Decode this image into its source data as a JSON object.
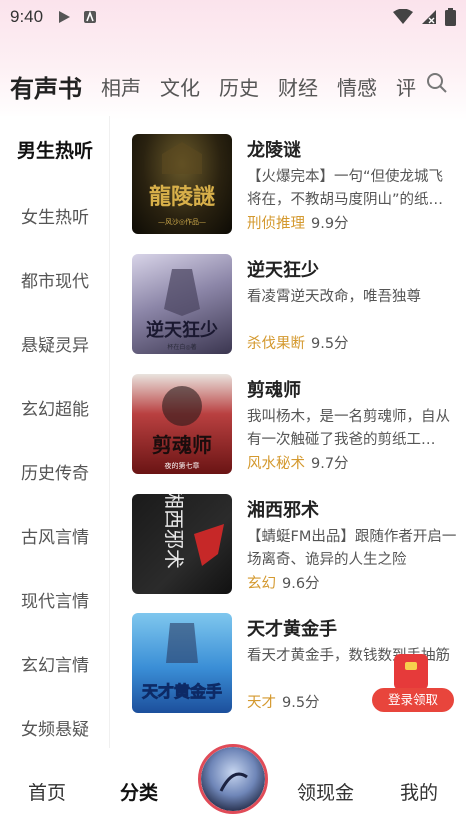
{
  "status_bar": {
    "time": "9:40"
  },
  "tabs": [
    "有声书",
    "相声",
    "文化",
    "历史",
    "财经",
    "情感",
    "评"
  ],
  "sidebar": [
    "男生热听",
    "女生热听",
    "都市现代",
    "悬疑灵异",
    "玄幻超能",
    "历史传奇",
    "古风言情",
    "现代言情",
    "玄幻言情",
    "女频悬疑"
  ],
  "books": [
    {
      "title": "龙陵谜",
      "description": "【火爆完本】一句“但使龙城飞将在，不教胡马度阴山”的纸…",
      "genre": "刑侦推理",
      "score": "9.9分",
      "cover_text": "龍陵謎",
      "cover_sub": "—风沙◎作品—"
    },
    {
      "title": "逆天狂少",
      "description": "看凌霄逆天改命，唯吾独尊",
      "genre": "杀伐果断",
      "score": "9.5分",
      "cover_text": "逆天狂少",
      "cover_sub": "杯在白◎著"
    },
    {
      "title": "剪魂师",
      "description": "我叫杨木，是一名剪魂师，自从有一次触碰了我爸的剪纸工…",
      "genre": "风水秘术",
      "score": "9.7分",
      "cover_text": "剪魂师",
      "cover_sub": "夜的第七章"
    },
    {
      "title": "湘西邪术",
      "description": "【蜻蜓FM出品】跟随作者开启一场离奇、诡异的人生之险",
      "genre": "玄幻",
      "score": "9.6分",
      "cover_text": "湘西邪术"
    },
    {
      "title": "天才黄金手",
      "description": "看天才黄金手，数钱数到手抽筋",
      "genre": "天才",
      "score": "9.5分",
      "cover_text": "天才黄金手"
    }
  ],
  "promo": {
    "label": "登录领取"
  },
  "bottom_nav": [
    "首页",
    "分类",
    "领现金",
    "我的"
  ],
  "colors": {
    "accent": "#e8404f",
    "genre": "#d4992f",
    "promo": "#e8453c"
  }
}
